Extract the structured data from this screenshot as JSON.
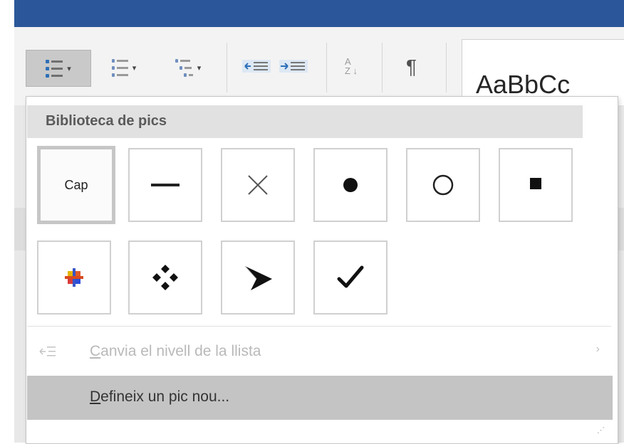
{
  "ribbon": {
    "styles_sample": "AaBbCc",
    "pilcrow": "¶",
    "bullets_caret": "▾",
    "numbering_caret": "▾",
    "multilevel_caret": "▾"
  },
  "panel": {
    "header": "Biblioteca de pics",
    "bullets": [
      {
        "name": "none",
        "label": "Cap"
      },
      {
        "name": "dash",
        "glyph": "—"
      },
      {
        "name": "cross",
        "glyph": "✕"
      },
      {
        "name": "filled-circle",
        "glyph": "●"
      },
      {
        "name": "hollow-circle",
        "glyph": "○"
      },
      {
        "name": "filled-square",
        "glyph": "■"
      },
      {
        "name": "color-plus",
        "glyph": ""
      },
      {
        "name": "four-diamonds",
        "glyph": ""
      },
      {
        "name": "arrowhead",
        "glyph": ""
      },
      {
        "name": "checkmark",
        "glyph": "✔"
      }
    ],
    "change_level": {
      "accel": "C",
      "rest": "anvia el nivell de la llista",
      "arrow": "›"
    },
    "define_new": {
      "accel": "D",
      "rest": "efineix un pic nou..."
    },
    "grip": "⋰"
  },
  "colors": {
    "title_bar": "#2b579a",
    "ribbon_bg": "#f3f3f3",
    "hover_row": "#c4c4c4",
    "list_icon_blue": "#2d6fb7"
  },
  "icons": [
    "bullet-list-icon",
    "numbered-list-icon",
    "multilevel-list-icon",
    "decrease-indent-icon",
    "increase-indent-icon",
    "sort-icon",
    "pilcrow-icon",
    "change-level-icon"
  ]
}
